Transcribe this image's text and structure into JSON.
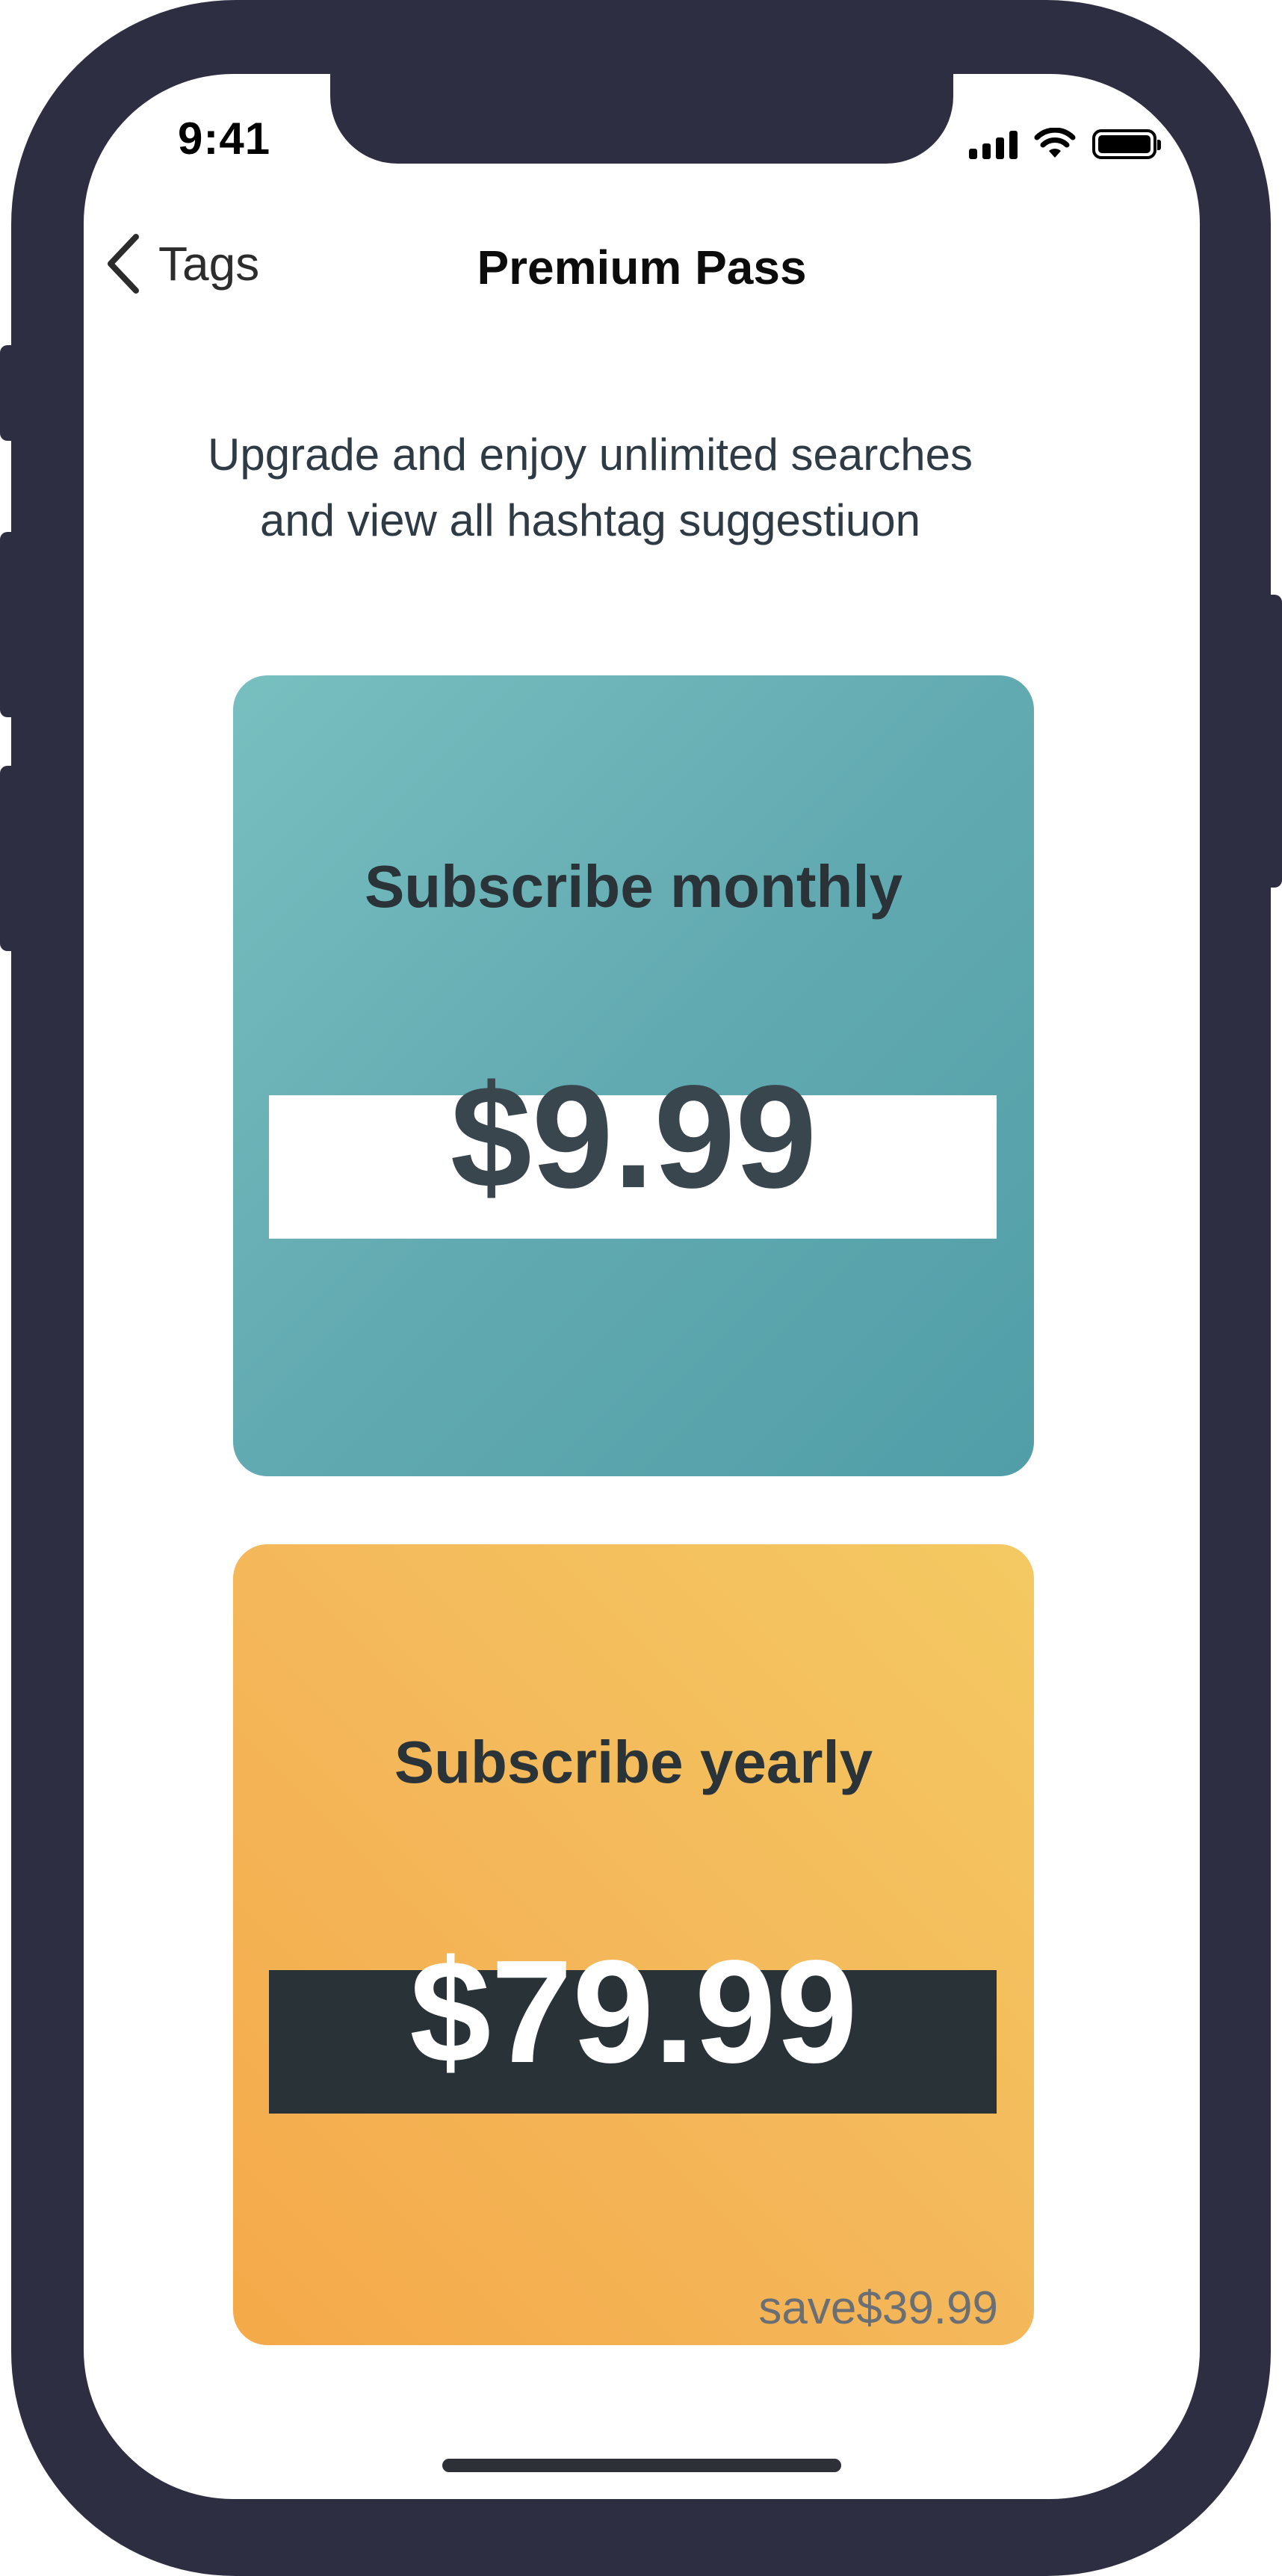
{
  "status_bar": {
    "time": "9:41",
    "icons": [
      "signal-icon",
      "wifi-icon",
      "battery-icon"
    ]
  },
  "nav": {
    "back_label": "Tags",
    "title": "Premium Pass"
  },
  "subtitle": "Upgrade and enjoy unlimited searches and view all hashtag suggestiuon",
  "plans": [
    {
      "title": "Subscribe monthly",
      "price": "$9.99",
      "colors": {
        "gradient_start": "#78bfc0",
        "gradient_end": "#519ea8",
        "band": "#ffffff",
        "price": "#3a464d"
      }
    },
    {
      "title": "Subscribe yearly",
      "price": "$79.99",
      "savings": "save$39.99",
      "colors": {
        "gradient_start": "#f5a949",
        "gradient_end": "#f4c962",
        "band": "#283237",
        "price": "#ffffff"
      }
    }
  ],
  "colors": {
    "frame": "#2d2e42",
    "text_dark": "#2a3338"
  }
}
